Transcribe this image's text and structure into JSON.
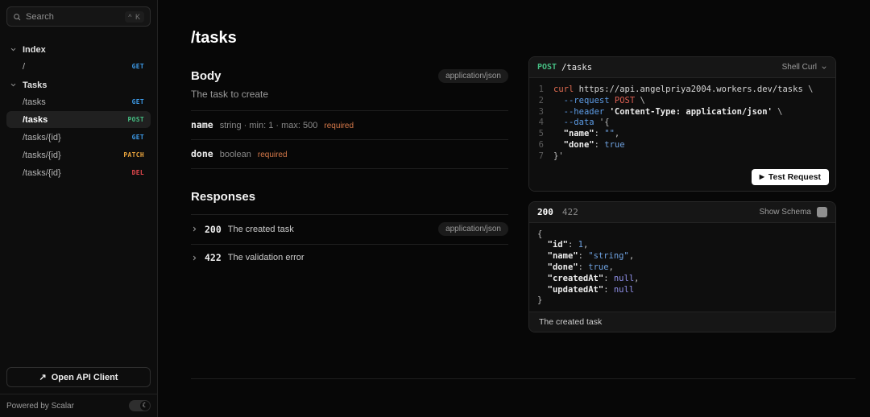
{
  "sidebar": {
    "search": {
      "placeholder": "Search",
      "shortcut": "^ K"
    },
    "groups": [
      {
        "label": "Index",
        "items": [
          {
            "path": "/",
            "method": "GET",
            "active": false
          }
        ]
      },
      {
        "label": "Tasks",
        "items": [
          {
            "path": "/tasks",
            "method": "GET",
            "active": false
          },
          {
            "path": "/tasks",
            "method": "POST",
            "active": true
          },
          {
            "path": "/tasks/{id}",
            "method": "GET",
            "active": false
          },
          {
            "path": "/tasks/{id}",
            "method": "PATCH",
            "active": false
          },
          {
            "path": "/tasks/{id}",
            "method": "DEL",
            "active": false
          }
        ]
      }
    ],
    "open_api_client_label": "Open API Client",
    "powered_by": "Powered by Scalar"
  },
  "icons": {
    "external_link": "↗",
    "play": "▶",
    "moon": "☾"
  },
  "method_colors": {
    "GET": "#3d9be9",
    "POST": "#45bd82",
    "PATCH": "#e8a33d",
    "DEL": "#e5484d"
  },
  "accent_colors": {
    "required": "#d87a4a"
  },
  "main": {
    "title": "/tasks",
    "body_heading": "Body",
    "body_content_type": "application/json",
    "body_description": "The task to create",
    "fields": [
      {
        "name": "name",
        "meta": "string · min: 1 · max: 500",
        "required": "required"
      },
      {
        "name": "done",
        "meta": "boolean",
        "required": "required"
      }
    ],
    "responses_heading": "Responses",
    "responses": [
      {
        "code": "200",
        "description": "The created task",
        "content_type": "application/json"
      },
      {
        "code": "422",
        "description": "The validation error",
        "content_type": ""
      }
    ]
  },
  "request_card": {
    "method": "POST",
    "path": "/tasks",
    "client": "Shell Curl",
    "test_button": "Test Request",
    "code": [
      [
        [
          "cmd",
          "curl"
        ],
        [
          "url",
          " https://api.angelpriya2004.workers.dev/tasks"
        ],
        [
          "plain",
          " \\"
        ]
      ],
      [
        [
          "plain",
          "  "
        ],
        [
          "flag",
          "--request"
        ],
        [
          "plain",
          " "
        ],
        [
          "method",
          "POST"
        ],
        [
          "plain",
          " \\"
        ]
      ],
      [
        [
          "plain",
          "  "
        ],
        [
          "flag",
          "--header"
        ],
        [
          "plain",
          " "
        ],
        [
          "key",
          "'Content-Type: application/json'"
        ],
        [
          "plain",
          " \\"
        ]
      ],
      [
        [
          "plain",
          "  "
        ],
        [
          "flag",
          "--data"
        ],
        [
          "plain",
          " '{"
        ]
      ],
      [
        [
          "plain",
          "  "
        ],
        [
          "key",
          "\"name\""
        ],
        [
          "plain",
          ": "
        ],
        [
          "str",
          "\"\""
        ],
        [
          "plain",
          ","
        ]
      ],
      [
        [
          "plain",
          "  "
        ],
        [
          "key",
          "\"done\""
        ],
        [
          "plain",
          ": "
        ],
        [
          "bool",
          "true"
        ]
      ],
      [
        [
          "plain",
          "}'"
        ]
      ]
    ]
  },
  "response_card": {
    "tabs": [
      {
        "label": "200",
        "active": true
      },
      {
        "label": "422",
        "active": false
      }
    ],
    "show_schema": "Show Schema",
    "footer": "The created task",
    "code": [
      [
        [
          "plain",
          "{"
        ]
      ],
      [
        [
          "plain",
          "  "
        ],
        [
          "key",
          "\"id\""
        ],
        [
          "plain",
          ": "
        ],
        [
          "num",
          "1"
        ],
        [
          "plain",
          ","
        ]
      ],
      [
        [
          "plain",
          "  "
        ],
        [
          "key",
          "\"name\""
        ],
        [
          "plain",
          ": "
        ],
        [
          "str",
          "\"string\""
        ],
        [
          "plain",
          ","
        ]
      ],
      [
        [
          "plain",
          "  "
        ],
        [
          "key",
          "\"done\""
        ],
        [
          "plain",
          ": "
        ],
        [
          "bool",
          "true"
        ],
        [
          "plain",
          ","
        ]
      ],
      [
        [
          "plain",
          "  "
        ],
        [
          "key",
          "\"createdAt\""
        ],
        [
          "plain",
          ": "
        ],
        [
          "null",
          "null"
        ],
        [
          "plain",
          ","
        ]
      ],
      [
        [
          "plain",
          "  "
        ],
        [
          "key",
          "\"updatedAt\""
        ],
        [
          "plain",
          ": "
        ],
        [
          "null",
          "null"
        ]
      ],
      [
        [
          "plain",
          "}"
        ]
      ]
    ]
  }
}
